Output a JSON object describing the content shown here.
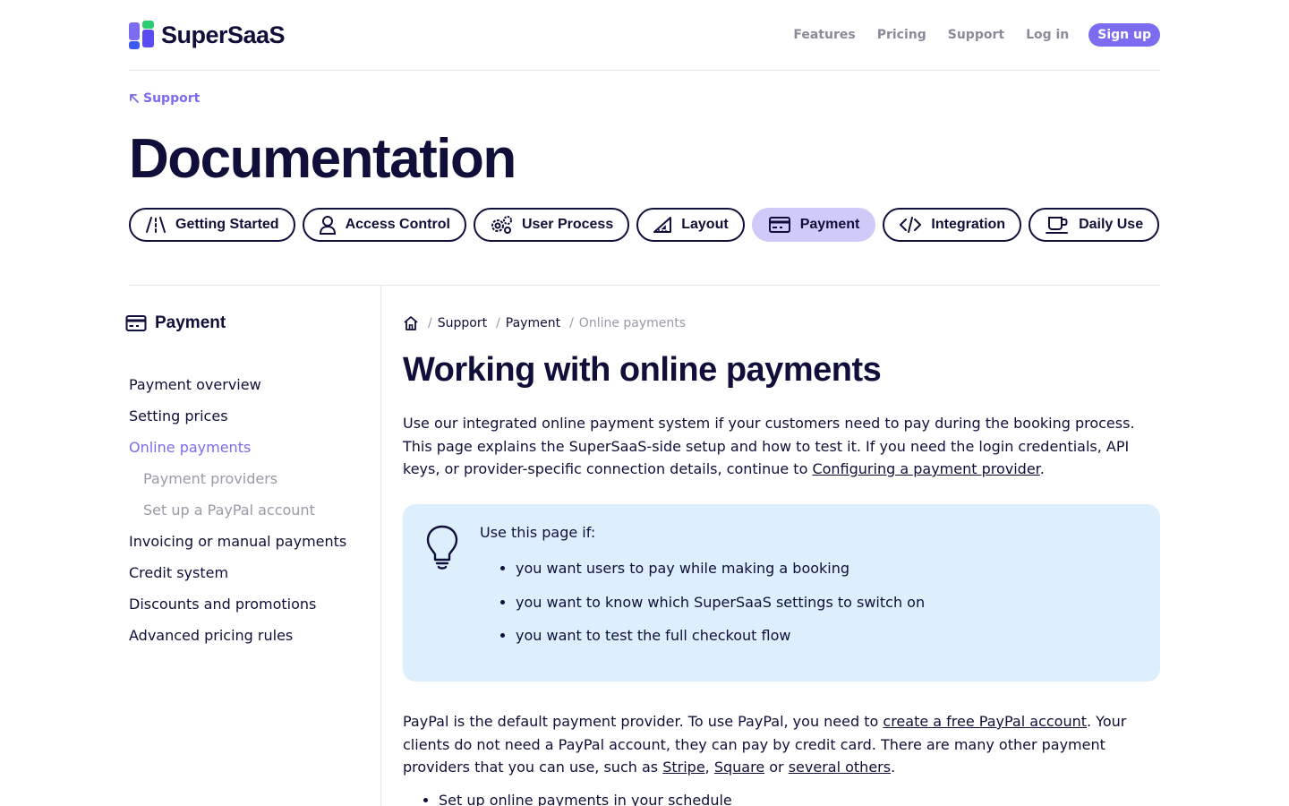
{
  "header": {
    "logo_text": "SuperSaaS",
    "nav": [
      {
        "label": "Features"
      },
      {
        "label": "Pricing"
      },
      {
        "label": "Support"
      },
      {
        "label": "Log in"
      }
    ],
    "signup_label": "Sign up",
    "accent_color": "#7b6cf0"
  },
  "back_link": "Support",
  "doc_title": "Documentation",
  "categories": [
    {
      "label": "Getting Started",
      "icon": "road-icon"
    },
    {
      "label": "Access Control",
      "icon": "user-icon"
    },
    {
      "label": "User Process",
      "icon": "gears-icon"
    },
    {
      "label": "Layout",
      "icon": "ruler-triangle-icon"
    },
    {
      "label": "Payment",
      "icon": "credit-card-icon",
      "active": true
    },
    {
      "label": "Integration",
      "icon": "code-icon"
    },
    {
      "label": "Daily Use",
      "icon": "coffee-cup-icon"
    }
  ],
  "sidebar": {
    "heading": "Payment",
    "items": [
      {
        "label": "Payment overview"
      },
      {
        "label": "Setting prices"
      },
      {
        "label": "Online payments",
        "current": true
      },
      {
        "label": "Payment providers",
        "sub": true
      },
      {
        "label": "Set up a PayPal account",
        "sub": true
      },
      {
        "label": "Invoicing or manual payments"
      },
      {
        "label": "Credit system"
      },
      {
        "label": "Discounts and promotions"
      },
      {
        "label": "Advanced pricing rules"
      }
    ]
  },
  "breadcrumb": {
    "items": [
      "Support",
      "Payment"
    ],
    "current": "Online payments"
  },
  "page_title": "Working with online payments",
  "intro": {
    "text": "Use our integrated online payment system if your customers need to pay during the booking process. This page explains the SuperSaaS-side setup and how to test it. If you need the login credentials, API keys, or provider-specific connection details, continue to ",
    "link": "Configuring a payment provider",
    "tail": "."
  },
  "callout": {
    "heading": "Use this page if:",
    "items": [
      "you want users to pay while making a booking",
      "you want to know which SuperSaaS settings to switch on",
      "you want to test the full checkout flow"
    ],
    "background": "#ddeefc"
  },
  "paypal_para": {
    "t1": "PayPal is the default payment provider. To use PayPal, you need to ",
    "link1": "create a free PayPal account",
    "t2": ". Your clients do not need a PayPal account, they can pay by credit card. There are many other payment providers that you can use, such as ",
    "link2": "Stripe",
    "t3": ", ",
    "link3": "Square",
    "t4": " or ",
    "link4": "several others",
    "t5": "."
  },
  "bottom_item": "Set up online payments in your schedule"
}
